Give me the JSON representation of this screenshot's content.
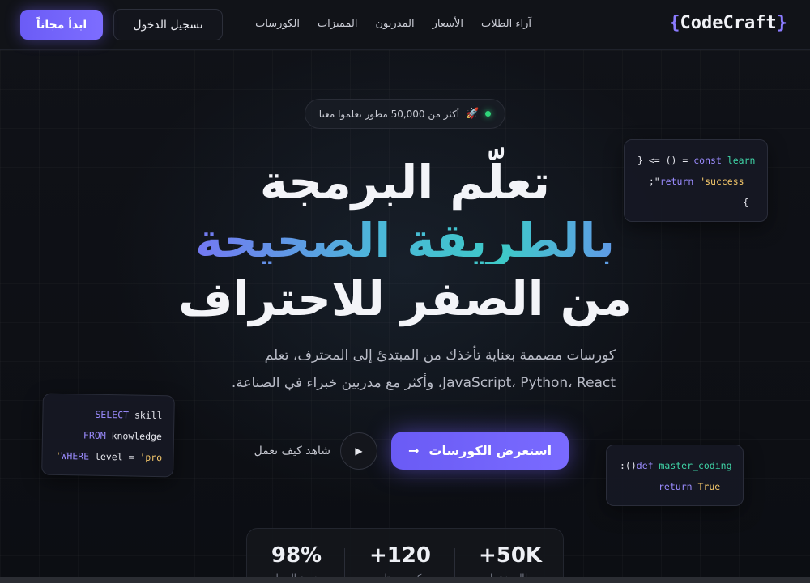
{
  "nav": {
    "logo_text": "CodeCraft",
    "logo_open": "{",
    "logo_close": "}",
    "links": [
      "الكورسات",
      "المميزات",
      "المدربون",
      "الأسعار",
      "آراء الطلاب"
    ],
    "login_label": "تسجيل الدخول",
    "start_label": "ابدأ مجاناً"
  },
  "badge": {
    "text": "أكثر من 50,000 مطور تعلموا معنا",
    "icon": "rocket-icon"
  },
  "hero": {
    "line1": "تعلّم البرمجة",
    "line2": "بالطريقة الصحيحة",
    "line3": "من الصفر للاحتراف",
    "subtitle_line1": "كورسات مصممة بعناية تأخذك من المبتدئ إلى المحترف، تعلم",
    "subtitle_line2": "JavaScript، Python، React، وأكثر مع مدربين خبراء في الصناعة."
  },
  "cta": {
    "courses_label": "استعرض الكورسات",
    "courses_arrow": "→",
    "watch_label": "شاهد كيف نعمل",
    "play_icon": "▶"
  },
  "code_cards": {
    "card1": {
      "l1_a": "} <= () = ",
      "l1_kw": "const",
      "l1_fn": " learn",
      "l2_a": "  ;\"",
      "l2_kw": "return",
      "l2_str": " \"success",
      "l3": "         {"
    },
    "card2": {
      "l1_kw": "SELECT",
      "l1_tx": " skill",
      "l2_kw": "FROM",
      "l2_tx": " knowledge",
      "l3_str1": "'",
      "l3_kw": "WHERE",
      "l3_tx": " level = ",
      "l3_str2": "'pro"
    },
    "card3": {
      "l1_tx": ":()",
      "l1_kw": "def",
      "l1_fn": " master_coding",
      "l2_kw": "return",
      "l2_str": " True"
    }
  },
  "stats": [
    {
      "num": "+50K",
      "label": "طالب نشط"
    },
    {
      "num": "+120",
      "label": "كورس متاح"
    },
    {
      "num": "98%",
      "label": "نسبة الرضا"
    }
  ],
  "colors": {
    "accent": "#7a6bff",
    "green_dot": "#2fd67a"
  }
}
